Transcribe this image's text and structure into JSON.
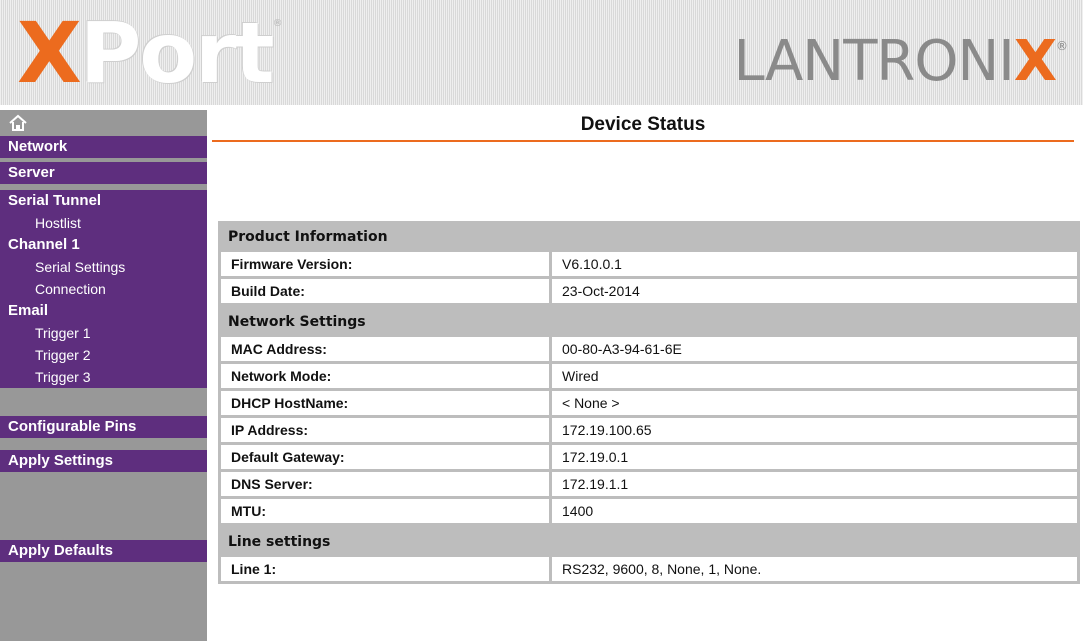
{
  "header": {
    "logo_left": {
      "first": "X",
      "rest": "Port",
      "tm": "®"
    },
    "logo_right": {
      "before": "LANTRONI",
      "accent": "X",
      "reg": "®"
    },
    "accent_color": "#ec6b1e"
  },
  "sidebar": {
    "home_icon": "home-icon",
    "items": [
      {
        "label": "Network",
        "kind": "head"
      },
      {
        "label": "Server",
        "kind": "head"
      },
      {
        "label": "Serial Tunnel",
        "kind": "head"
      },
      {
        "label": "Hostlist",
        "kind": "sub"
      },
      {
        "label": "Channel 1",
        "kind": "head"
      },
      {
        "label": "Serial Settings",
        "kind": "sub"
      },
      {
        "label": "Connection",
        "kind": "sub"
      },
      {
        "label": "Email",
        "kind": "head"
      },
      {
        "label": "Trigger 1",
        "kind": "sub"
      },
      {
        "label": "Trigger 2",
        "kind": "sub"
      },
      {
        "label": "Trigger 3",
        "kind": "sub"
      },
      {
        "label": "Configurable Pins",
        "kind": "head"
      },
      {
        "label": "Apply Settings",
        "kind": "head"
      },
      {
        "label": "Apply Defaults",
        "kind": "head"
      }
    ],
    "color": "#5e2e7e"
  },
  "main": {
    "title": "Device Status",
    "sections": [
      {
        "heading": "Product Information",
        "rows": [
          {
            "label": "Firmware Version:",
            "value": "V6.10.0.1"
          },
          {
            "label": "Build Date:",
            "value": "23-Oct-2014"
          }
        ]
      },
      {
        "heading": "Network Settings",
        "rows": [
          {
            "label": "MAC Address:",
            "value": "00-80-A3-94-61-6E"
          },
          {
            "label": "Network Mode:",
            "value": "Wired"
          },
          {
            "label": "DHCP HostName:",
            "value": "< None >"
          },
          {
            "label": "IP Address:",
            "value": "172.19.100.65"
          },
          {
            "label": "Default Gateway:",
            "value": "172.19.0.1"
          },
          {
            "label": "DNS Server:",
            "value": "172.19.1.1"
          },
          {
            "label": "MTU:",
            "value": "1400"
          }
        ]
      },
      {
        "heading": "Line settings",
        "rows": [
          {
            "label": "Line 1:",
            "value": "RS232, 9600, 8, None, 1, None."
          }
        ]
      }
    ]
  }
}
